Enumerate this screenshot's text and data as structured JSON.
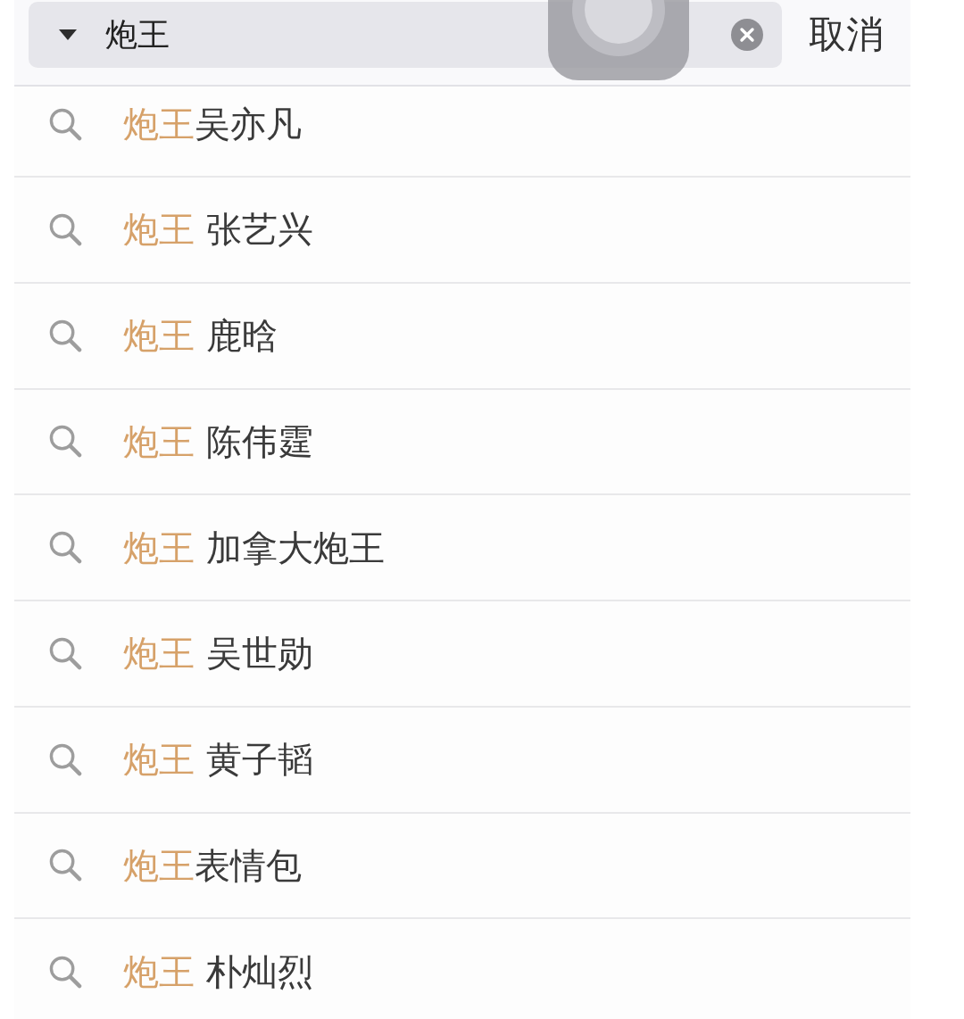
{
  "search_bar": {
    "value": "炮王",
    "cancel_label": "取消"
  },
  "suggestions": [
    {
      "match": "炮王",
      "rest": "吴亦凡"
    },
    {
      "match": "炮王",
      "rest": " 张艺兴"
    },
    {
      "match": "炮王",
      "rest": " 鹿晗"
    },
    {
      "match": "炮王",
      "rest": " 陈伟霆"
    },
    {
      "match": "炮王",
      "rest": " 加拿大炮王"
    },
    {
      "match": "炮王",
      "rest": " 吴世勋"
    },
    {
      "match": "炮王",
      "rest": " 黄子韬"
    },
    {
      "match": "炮王",
      "rest": "表情包"
    },
    {
      "match": "炮王",
      "rest": " 朴灿烈"
    }
  ]
}
